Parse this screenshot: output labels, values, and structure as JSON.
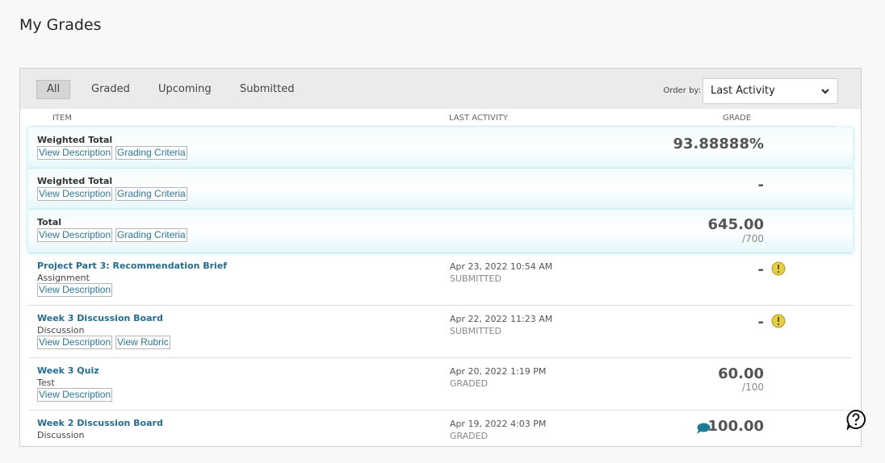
{
  "page": {
    "title": "My Grades"
  },
  "filters": [
    "All",
    "Graded",
    "Upcoming",
    "Submitted"
  ],
  "order": {
    "label": "Order by:",
    "selected": "Last Activity"
  },
  "columns": {
    "item": "ITEM",
    "last_activity": "LAST ACTIVITY",
    "grade": "GRADE"
  },
  "summary_rows": [
    {
      "name": "Weighted Total",
      "links": [
        "View Description",
        "Grading Criteria"
      ],
      "grade": "93.88888%",
      "grade_sub": ""
    },
    {
      "name": "Weighted Total",
      "links": [
        "View Description",
        "Grading Criteria"
      ],
      "grade": "-",
      "grade_sub": ""
    },
    {
      "name": "Total",
      "links": [
        "View Description",
        "Grading Criteria"
      ],
      "grade": "645.00",
      "grade_sub": "/700"
    }
  ],
  "items": [
    {
      "name": "Project Part 3: Recommendation Brief",
      "type": "Assignment",
      "links": [
        "View Description"
      ],
      "date": "Apr 23, 2022 10:54 AM",
      "status": "SUBMITTED",
      "grade": "-",
      "grade_sub": "",
      "icon": "needs-grading-icon"
    },
    {
      "name": "Week 3 Discussion Board",
      "type": "Discussion",
      "links": [
        "View Description",
        "View Rubric"
      ],
      "date": "Apr 22, 2022 11:23 AM",
      "status": "SUBMITTED",
      "grade": "-",
      "grade_sub": "",
      "icon": "needs-grading-icon"
    },
    {
      "name": "Week 3 Quiz",
      "type": "Test",
      "links": [
        "View Description"
      ],
      "date": "Apr 20, 2022 1:19 PM",
      "status": "GRADED",
      "grade": "60.00",
      "grade_sub": "/100",
      "icon": ""
    },
    {
      "name": "Week 2 Discussion Board",
      "type": "Discussion",
      "links": [],
      "date": "Apr 19, 2022 4:03 PM",
      "status": "GRADED",
      "grade": "100.00",
      "grade_sub": "",
      "icon": "comment-icon"
    }
  ],
  "colors": {
    "link": "#266c8f",
    "alert": "#c9b227",
    "comment": "#1f7a96"
  }
}
